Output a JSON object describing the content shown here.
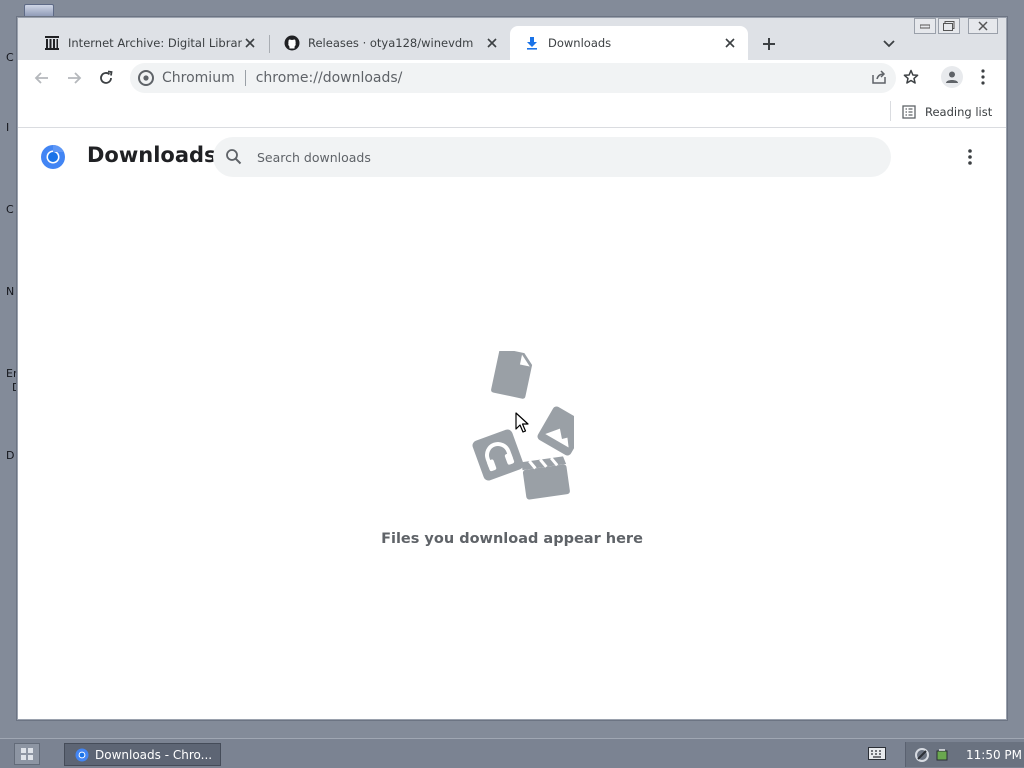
{
  "desktop": {
    "icon_letters": [
      "C",
      "I",
      "C",
      "N",
      "Er",
      "D",
      "D"
    ]
  },
  "browser": {
    "tabs": [
      {
        "title": "Internet Archive: Digital Library",
        "icon": "archive-icon",
        "active": false
      },
      {
        "title": "Releases · otya128/winevdm",
        "icon": "github-icon",
        "active": false
      },
      {
        "title": "Downloads",
        "icon": "download-icon",
        "active": true
      }
    ],
    "omnibox": {
      "site_name": "Chromium",
      "url": "chrome://downloads/"
    },
    "bookmarks": {
      "reading_list": "Reading list"
    }
  },
  "downloads_page": {
    "title": "Downloads",
    "search_placeholder": "Search downloads",
    "empty_message": "Files you download appear here"
  },
  "taskbar": {
    "task_label": "Downloads - Chro...",
    "clock": "11:50 PM"
  },
  "colors": {
    "accent_blue": "#1a73e8",
    "illustration_gray": "#9aa0a6"
  }
}
